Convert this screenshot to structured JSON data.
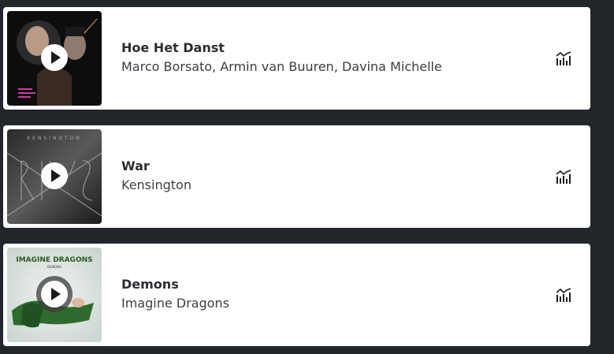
{
  "tracks": [
    {
      "title": "Hoe Het Danst",
      "artist": "Marco Borsato, Armin van Buuren, Davina Michelle",
      "cover_icon": "album-cover-hoe-het-danst",
      "action_icon": "chart-stats-icon"
    },
    {
      "title": "War",
      "artist": "Kensington",
      "cover_text": "KENSINGTON",
      "cover_icon": "album-cover-war",
      "action_icon": "chart-stats-icon"
    },
    {
      "title": "Demons",
      "artist": "Imagine Dragons",
      "cover_text_top": "IMAGINE DRAGONS",
      "cover_text_sub": "DEMONS",
      "cover_icon": "album-cover-demons",
      "action_icon": "chart-stats-icon"
    }
  ],
  "colors": {
    "background": "#22262b",
    "card": "#ffffff",
    "title_text": "#2a2d31",
    "artist_text": "#3b3f44"
  }
}
